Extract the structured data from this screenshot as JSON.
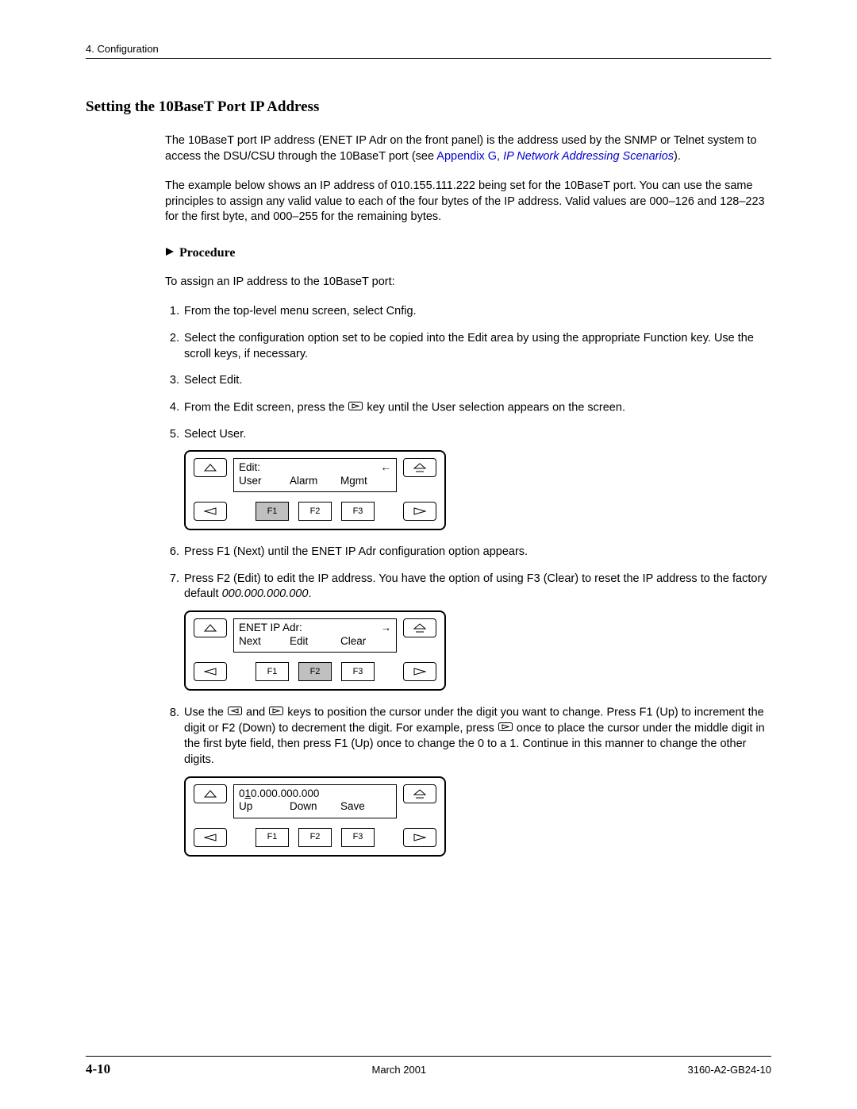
{
  "header": {
    "label": "4. Configuration"
  },
  "heading": "Setting the 10BaseT Port IP Address",
  "intro1_a": "The 10BaseT port IP address (ENET IP Adr on the front panel) is the address used by the SNMP or Telnet system to access the DSU/CSU through the 10BaseT port (see ",
  "intro1_link1": "Appendix G, ",
  "intro1_link2": "IP Network Addressing Scenarios",
  "intro1_b": ").",
  "intro2": "The example below shows an IP address of 010.155.111.222 being set for the 10BaseT port. You can use the same principles to assign any valid value to each of the four bytes of the IP address. Valid values are 000–126 and 128–223 for the first byte, and 000–255 for the remaining bytes.",
  "procedure_label": "Procedure",
  "lead_in": "To assign an IP address to the 10BaseT port:",
  "steps": {
    "s1": "From the top-level menu screen, select Cnfig.",
    "s2": "Select the configuration option set to be copied into the Edit area by using the appropriate Function key. Use the scroll keys, if necessary.",
    "s3": "Select Edit.",
    "s4a": "From the Edit screen, press the ",
    "s4b": " key until the User selection appears on the screen.",
    "s5": "Select User.",
    "s6": "Press F1 (Next) until the ENET IP Adr configuration option appears.",
    "s7a": "Press F2 (Edit) to edit the IP address. You have the option of using F3 (Clear) to reset the IP address to the factory default ",
    "s7_ital": "000.000.000.000",
    "s7b": ".",
    "s8a": "Use the ",
    "s8b": " and ",
    "s8c": " keys to position the cursor under the digit you want to change. Press F1 (Up) to increment the digit or F2 (Down) to decrement the digit. For example, press ",
    "s8d": " once to place the cursor under the middle digit in the first byte field, then press F1 (Up) once to change the 0 to a 1. Continue in this manner to change the other digits."
  },
  "panel1": {
    "title": "Edit:",
    "arrow": "←",
    "opt1": "User",
    "opt2": "Alarm",
    "opt3": "Mgmt",
    "f1": "F1",
    "f2": "F2",
    "f3": "F3"
  },
  "panel2": {
    "title": "ENET IP Adr:",
    "arrow": "→",
    "opt1": "Next",
    "opt2": "Edit",
    "opt3": "Clear",
    "f1": "F1",
    "f2": "F2",
    "f3": "F3"
  },
  "panel3": {
    "title_pre": "0",
    "title_u": "1",
    "title_post": "0.000.000.000",
    "opt1": "Up",
    "opt2": "Down",
    "opt3": "Save",
    "f1": "F1",
    "f2": "F2",
    "f3": "F3"
  },
  "footer": {
    "page": "4-10",
    "center": "March 2001",
    "right": "3160-A2-GB24-10"
  }
}
